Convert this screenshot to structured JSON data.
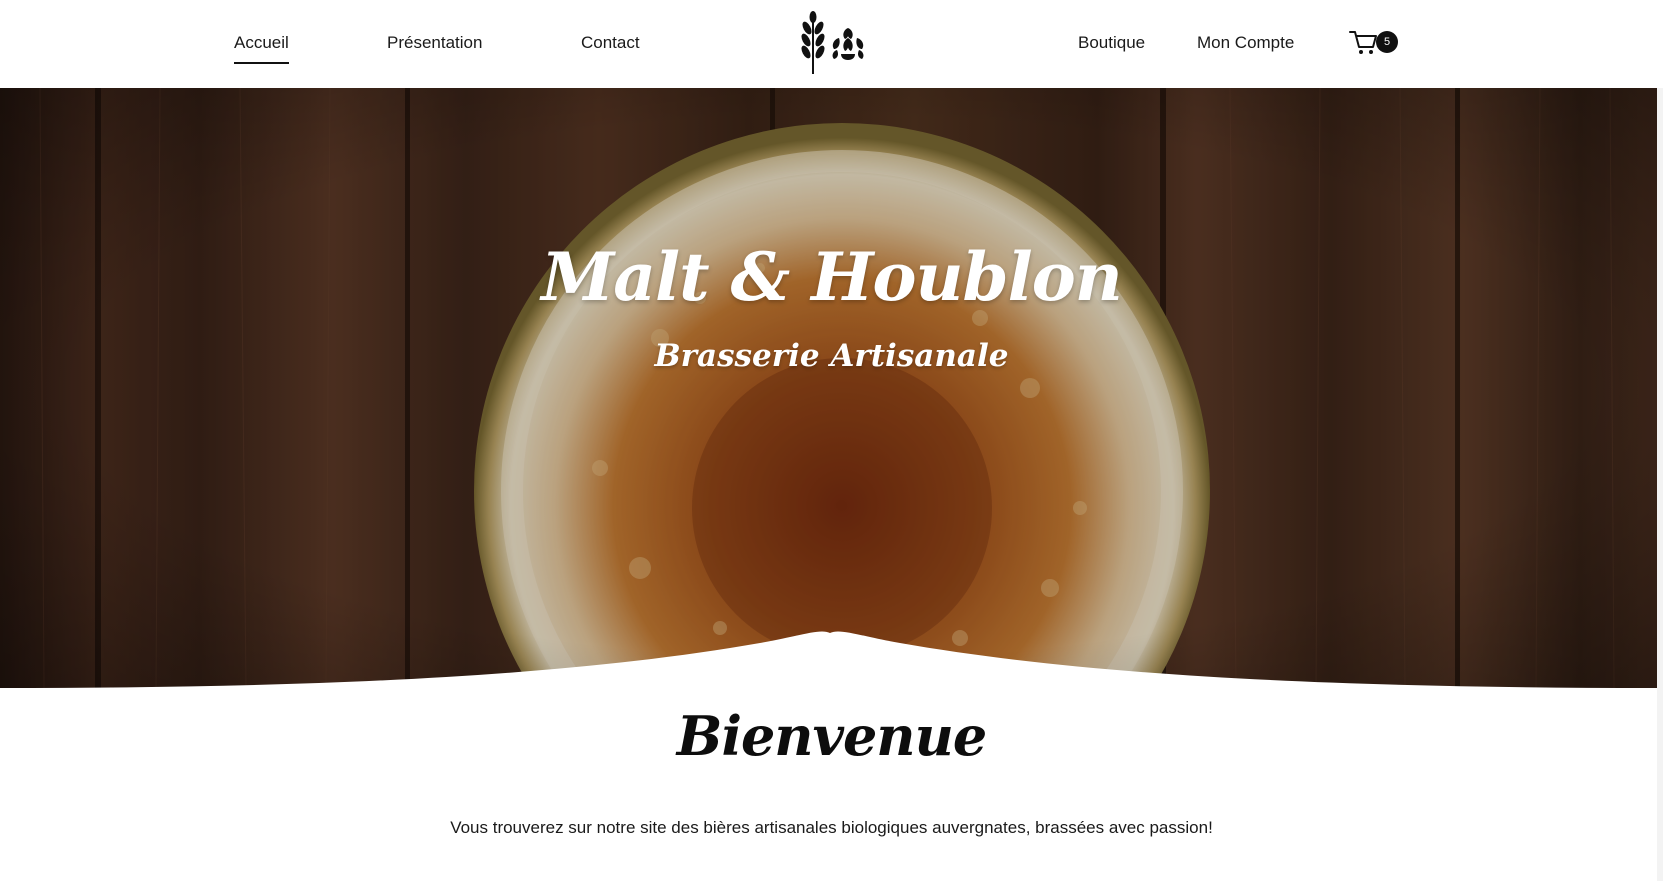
{
  "nav": {
    "left": [
      {
        "label": "Accueil",
        "active": true
      },
      {
        "label": "Présentation",
        "active": false
      },
      {
        "label": "Contact",
        "active": false
      }
    ],
    "right": [
      {
        "label": "Boutique"
      },
      {
        "label": "Mon Compte"
      }
    ],
    "logo_icon": "wheat-and-hop-icon",
    "cart": {
      "icon": "shopping-cart-icon",
      "count": "5"
    }
  },
  "hero": {
    "title": "Malt & Houblon",
    "subtitle": "Brasserie Artisanale",
    "image": "beer-glass-top-view-on-wooden-table"
  },
  "welcome": {
    "title": "Bienvenue",
    "text": "Vous trouverez sur notre site des bières artisanales biologiques auvergnates, brassées avec passion!"
  },
  "colors": {
    "wood_dark": "#3a2418",
    "wood_mid": "#5a3826",
    "beer_amber": "#a8561c",
    "foam": "#f0e4c8",
    "text": "#111111"
  }
}
